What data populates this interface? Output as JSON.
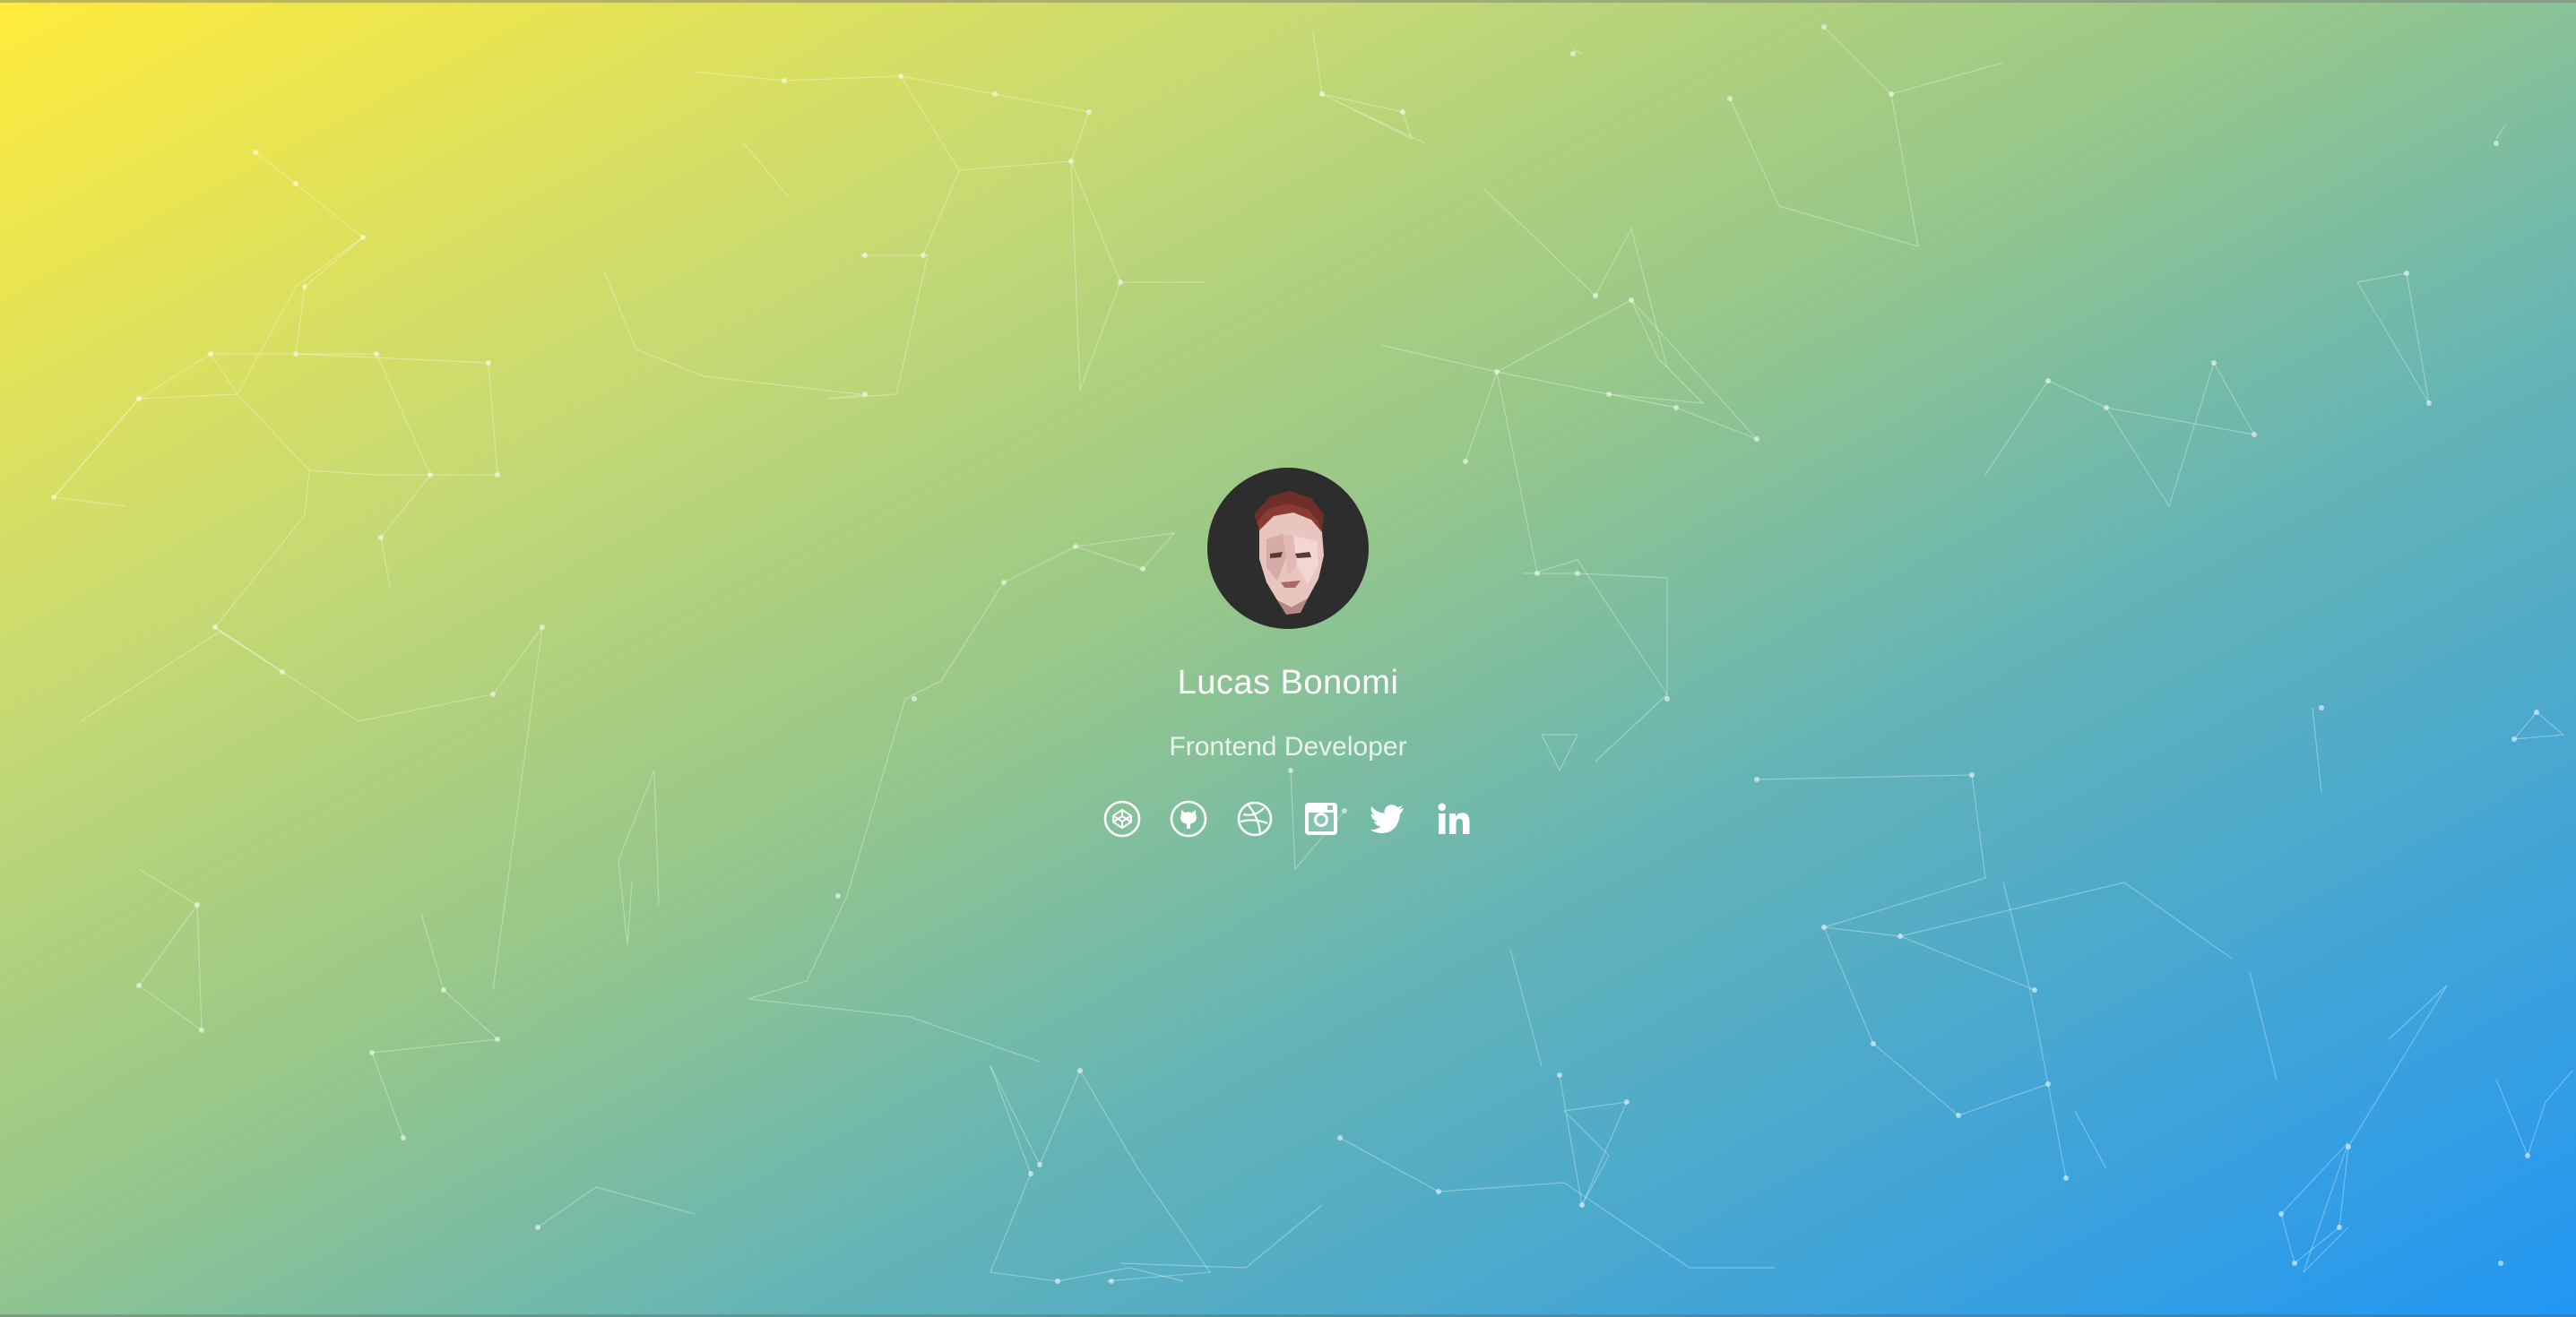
{
  "profile": {
    "name": "Lucas Bonomi",
    "role": "Frontend Developer"
  },
  "social_links": [
    {
      "icon": "codepen-icon"
    },
    {
      "icon": "github-icon"
    },
    {
      "icon": "dribbble-icon"
    },
    {
      "icon": "instagram-icon"
    },
    {
      "icon": "twitter-icon"
    },
    {
      "icon": "linkedin-icon"
    }
  ],
  "colors": {
    "gradient_start": "#ffeb3b",
    "gradient_end": "#2196f3",
    "avatar_background": "#2d2d2d",
    "text": "#ffffff"
  }
}
